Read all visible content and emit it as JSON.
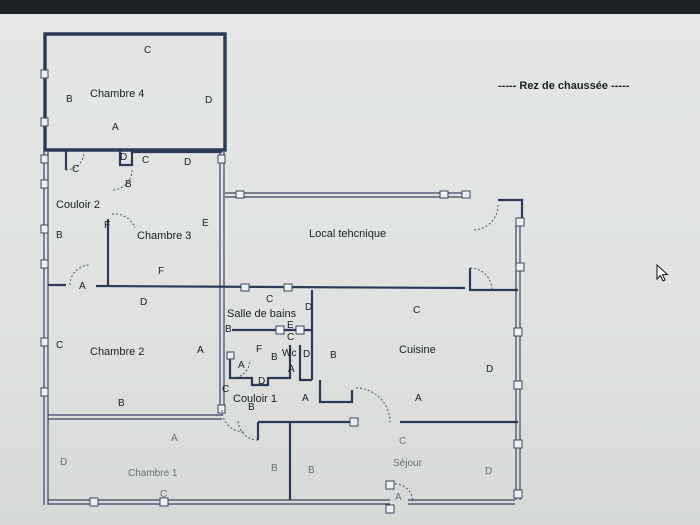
{
  "plan": {
    "title": "----- Rez de chaussée -----",
    "rooms": {
      "chambre4": "Chambre 4",
      "couloir2": "Couloir 2",
      "chambre3": "Chambre 3",
      "local": "Local tehcnique",
      "salle_bains": "Salle de bains",
      "chambre2": "Chambre 2",
      "cuisine": "Cuisine",
      "wc": "Wc",
      "couloir1": "Couloir 1",
      "chambre1": "Chambre 1",
      "sejour": "Séjour"
    },
    "wall_letters": {
      "c4_top": "C",
      "c4_left": "B",
      "c4_right": "D",
      "c4_bottom": "A",
      "cor2_c": "C",
      "cor2_d": "D",
      "cor2_c2": "C",
      "cor2_d2": "D",
      "cor2_b": "B",
      "cor2_left": "B",
      "c3_f": "F",
      "c3_e": "E",
      "c3_f2": "F",
      "c3_a": "A",
      "c2_d": "D",
      "c2_c": "C",
      "c2_a": "A",
      "c2_b": "B",
      "sb_c": "C",
      "sb_b": "B",
      "sb_d": "D",
      "sb_e": "E",
      "sb_c2": "C",
      "sb_f": "F",
      "wc_b": "B",
      "wc_d": "D",
      "wc_a": "A",
      "wc_a2": "A",
      "wc_d2": "D",
      "cor1_c": "C",
      "cor1_b": "B",
      "cor1_a": "A",
      "cu_c": "C",
      "cu_b": "B",
      "cu_d": "D",
      "cu_a": "A",
      "c1_a": "A",
      "c1_d": "D",
      "c1_b": "B",
      "c1_c": "C",
      "sej_c": "C",
      "sej_b": "B",
      "sej_d": "D",
      "sej_a": "A"
    }
  }
}
